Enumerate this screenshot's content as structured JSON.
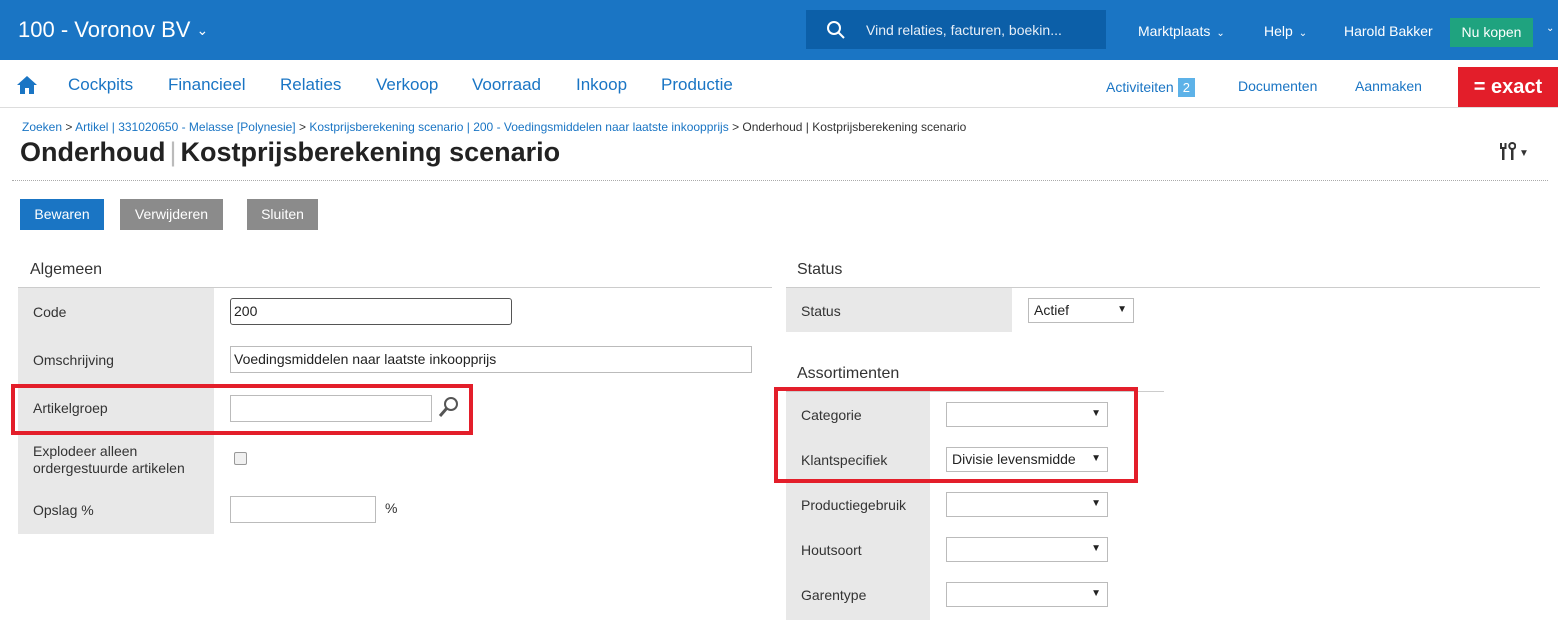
{
  "topbar": {
    "company": "100 - Voronov BV",
    "search_placeholder": "Vind relaties, facturen, boekin...",
    "marketplace": "Marktplaats",
    "help": "Help",
    "user": "Harold Bakker",
    "buy": "Nu kopen"
  },
  "nav": {
    "items": [
      "Cockpits",
      "Financieel",
      "Relaties",
      "Verkoop",
      "Voorraad",
      "Inkoop",
      "Productie"
    ],
    "activities": "Activiteiten",
    "activities_count": "2",
    "documents": "Documenten",
    "create": "Aanmaken",
    "brand": "= exact"
  },
  "breadcrumb": {
    "items": [
      "Zoeken",
      "Artikel | 331020650 - Melasse [Polynesie]",
      "Kostprijsberekening scenario | 200 - Voedingsmiddelen naar laatste inkoopprijs"
    ],
    "separator": ">",
    "current": "Onderhoud | Kostprijsberekening scenario"
  },
  "page": {
    "title_part1": "Onderhoud",
    "title_sep": "|",
    "title_part2": "Kostprijsberekening scenario"
  },
  "toolbar": {
    "save": "Bewaren",
    "delete": "Verwijderen",
    "close": "Sluiten"
  },
  "general": {
    "title": "Algemeen",
    "code_label": "Code",
    "code_value": "200",
    "description_label": "Omschrijving",
    "description_value": "Voedingsmiddelen naar laatste inkoopprijs",
    "item_group_label": "Artikelgroep",
    "item_group_value": "",
    "explode_label_1": "Explodeer alleen",
    "explode_label_2": "ordergestuurde artikelen",
    "explode_checked": false,
    "markup_label": "Opslag %",
    "markup_value": "",
    "markup_unit": "%"
  },
  "status": {
    "title": "Status",
    "status_label": "Status",
    "status_value": "Actief"
  },
  "assortments": {
    "title": "Assortimenten",
    "rows": [
      {
        "label": "Categorie",
        "value": ""
      },
      {
        "label": "Klantspecifiek",
        "value": "Divisie levensmidde"
      },
      {
        "label": "Productiegebruik",
        "value": ""
      },
      {
        "label": "Houtsoort",
        "value": ""
      },
      {
        "label": "Garentype",
        "value": ""
      }
    ]
  },
  "colors": {
    "primary": "#1a75c4",
    "buy": "#1fa37f",
    "brand_red": "#e31e2a",
    "highlight_box": "#e31e2a"
  }
}
